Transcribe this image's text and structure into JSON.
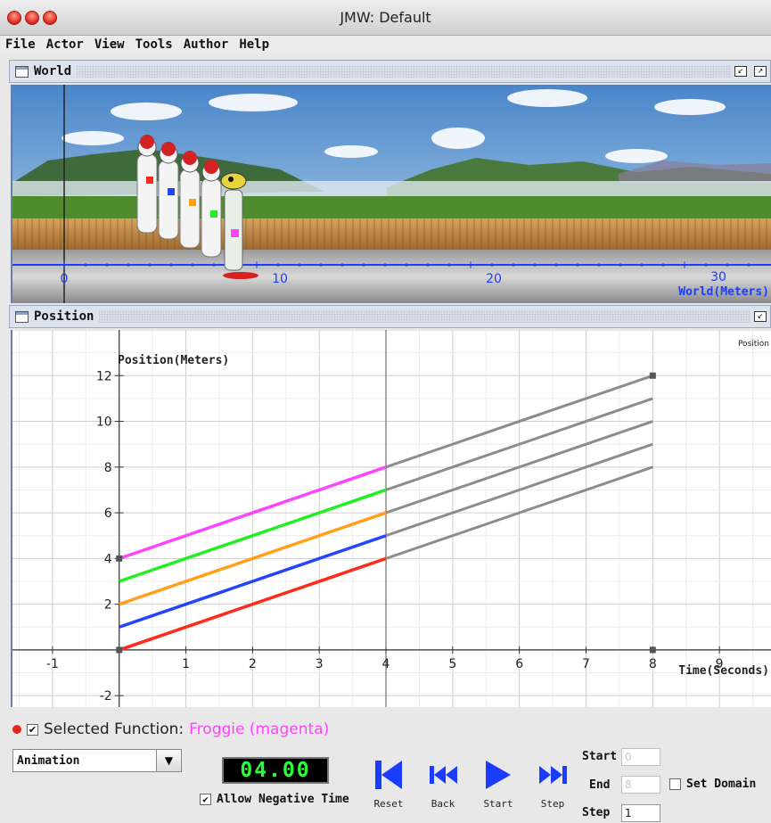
{
  "window": {
    "title": "JMW: Default"
  },
  "menu": [
    "File",
    "Actor",
    "View",
    "Tools",
    "Author",
    "Help"
  ],
  "world": {
    "title": "World",
    "axis_label": "World(Meters)",
    "ticks": [
      "0",
      "10",
      "20",
      "30"
    ]
  },
  "position": {
    "title": "Position",
    "legend": "Position"
  },
  "chart_data": {
    "type": "line",
    "xlabel": "Time(Seconds)",
    "ylabel": "Position(Meters)",
    "xlim": [
      -1.6,
      9.8
    ],
    "ylim": [
      -2.5,
      14
    ],
    "x_ticks": [
      -1,
      1,
      2,
      3,
      4,
      5,
      6,
      7,
      8,
      9
    ],
    "y_ticks": [
      -2,
      2,
      4,
      6,
      8,
      10,
      12
    ],
    "series": [
      {
        "color": "#ff44ff",
        "values": [
          [
            0,
            4
          ],
          [
            4,
            8
          ]
        ],
        "continuation": [
          [
            4,
            8
          ],
          [
            8,
            12
          ]
        ]
      },
      {
        "color": "#22ee22",
        "values": [
          [
            0,
            3
          ],
          [
            4,
            7
          ]
        ],
        "continuation": [
          [
            4,
            7
          ],
          [
            8,
            11
          ]
        ]
      },
      {
        "color": "#ff9f1a",
        "values": [
          [
            0,
            2
          ],
          [
            4,
            6
          ]
        ],
        "continuation": [
          [
            4,
            6
          ],
          [
            8,
            10
          ]
        ]
      },
      {
        "color": "#2244ff",
        "values": [
          [
            0,
            1
          ],
          [
            4,
            5
          ]
        ],
        "continuation": [
          [
            4,
            5
          ],
          [
            8,
            9
          ]
        ]
      },
      {
        "color": "#ff2a1a",
        "values": [
          [
            0,
            0
          ],
          [
            4,
            4
          ]
        ],
        "continuation": [
          [
            4,
            4
          ],
          [
            8,
            8
          ]
        ]
      }
    ],
    "continuation_color": "#8c8c8c",
    "current_time": 4,
    "grid": true
  },
  "selected": {
    "prefix": "Selected Function:",
    "name": "Froggie (magenta)"
  },
  "controls": {
    "mode": "Animation",
    "time_display": "04.00",
    "allow_negative": "Allow Negative Time",
    "reset": "Reset",
    "back": "Back",
    "start": "Start",
    "step": "Step",
    "start_label": "Start",
    "start_value": "0",
    "end_label": "End",
    "end_value": "8",
    "step_label": "Step",
    "step_value": "1",
    "set_domain": "Set Domain"
  },
  "colors": {
    "accent_blue": "#1a3cff",
    "clock_green": "#28ff3c"
  }
}
